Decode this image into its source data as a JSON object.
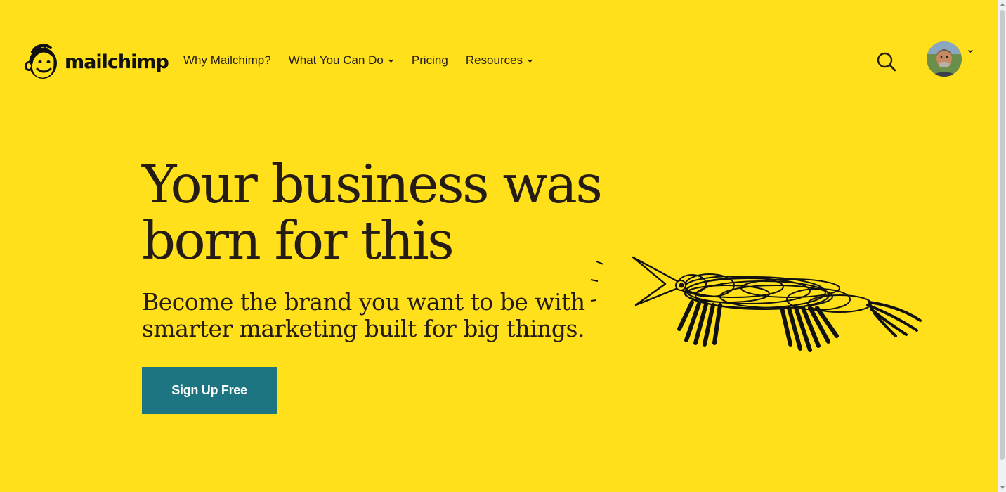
{
  "brand": {
    "name": "mailchimp",
    "color_background": "#ffe01b",
    "color_cta": "#1c7580",
    "color_text": "#241c15"
  },
  "nav": {
    "items": [
      {
        "label": "Why Mailchimp?",
        "has_dropdown": false
      },
      {
        "label": "What You Can Do",
        "has_dropdown": true
      },
      {
        "label": "Pricing",
        "has_dropdown": false
      },
      {
        "label": "Resources",
        "has_dropdown": true
      }
    ]
  },
  "header": {
    "search_icon": "search-icon",
    "avatar_icon": "user-avatar",
    "avatar_dropdown_icon": "chevron-down-icon"
  },
  "hero": {
    "title": "Your business was born for this",
    "subtitle": "Become the brand you want to be with smarter marketing built for big things.",
    "cta_label": "Sign Up Free",
    "illustration": "bird-illustration"
  }
}
